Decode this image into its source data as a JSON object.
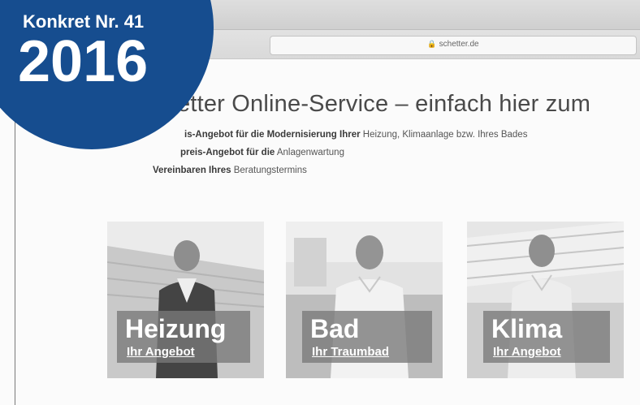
{
  "badge": {
    "issue": "Konkret Nr. 41",
    "year": "2016",
    "color": "#164d8f"
  },
  "browser": {
    "url": "schetter.de",
    "lock_icon": "lock-icon"
  },
  "page": {
    "title": "etter Online-Service – einfach hier zum",
    "bullets": [
      {
        "bold": "is-Angebot für die Modernisierung Ihrer",
        "plain": " Heizung, Klimaanlage bzw. Ihres Bades"
      },
      {
        "bold": "preis-Angebot für die",
        "plain": " Anlagenwartung"
      },
      {
        "bold": "Vereinbaren Ihres",
        "plain": " Beratungstermins"
      }
    ]
  },
  "cards": [
    {
      "title": "Heizung",
      "subtitle": "Ihr Angebot"
    },
    {
      "title": "Bad",
      "subtitle": "Ihr Traumbad"
    },
    {
      "title": "Klima",
      "subtitle": "Ihr Angebot"
    }
  ]
}
